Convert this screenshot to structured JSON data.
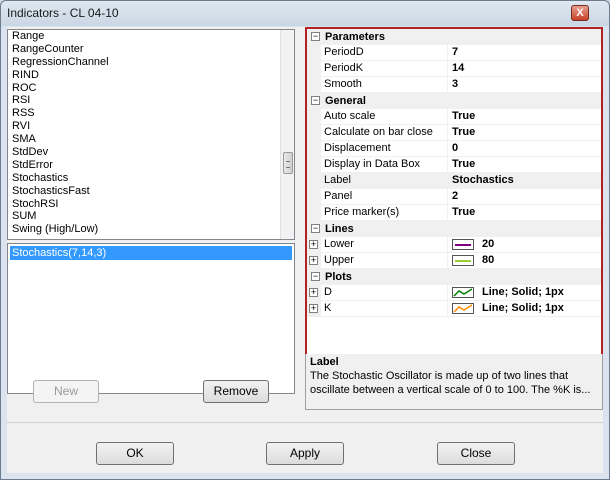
{
  "window": {
    "title": "Indicators - CL 04-10",
    "close_glyph": "X"
  },
  "indicator_list": {
    "items": [
      "Range",
      "RangeCounter",
      "RegressionChannel",
      "RIND",
      "ROC",
      "RSI",
      "RSS",
      "RVI",
      "SMA",
      "StdDev",
      "StdError",
      "Stochastics",
      "StochasticsFast",
      "StochRSI",
      "SUM",
      "Swing (High/Low)"
    ]
  },
  "applied_list": {
    "items": [
      "Stochastics(7,14,3)"
    ]
  },
  "buttons": {
    "new": "New",
    "remove": "Remove",
    "ok": "OK",
    "apply": "Apply",
    "close": "Close"
  },
  "properties": {
    "parameters": {
      "label": "Parameters",
      "rows": [
        {
          "name": "PeriodD",
          "value": "7"
        },
        {
          "name": "PeriodK",
          "value": "14"
        },
        {
          "name": "Smooth",
          "value": "3"
        }
      ]
    },
    "general": {
      "label": "General",
      "rows": [
        {
          "name": "Auto scale",
          "value": "True"
        },
        {
          "name": "Calculate on bar close",
          "value": "True"
        },
        {
          "name": "Displacement",
          "value": "0"
        },
        {
          "name": "Display in Data Box",
          "value": "True"
        },
        {
          "name": "Label",
          "value": "Stochastics"
        },
        {
          "name": "Panel",
          "value": "2"
        },
        {
          "name": "Price marker(s)",
          "value": "True"
        }
      ]
    },
    "lines": {
      "label": "Lines",
      "rows": [
        {
          "name": "Lower",
          "value": "20",
          "color": "#800080"
        },
        {
          "name": "Upper",
          "value": "80",
          "color": "#9acd32"
        }
      ]
    },
    "plots": {
      "label": "Plots",
      "rows": [
        {
          "name": "D",
          "value": "Line; Solid; 1px",
          "color": "#008000"
        },
        {
          "name": "K",
          "value": "Line; Solid; 1px",
          "color": "#ff8c00"
        }
      ]
    }
  },
  "description": {
    "title": "Label",
    "text": "The Stochastic Oscillator is made up of two lines that oscillate between a vertical scale of 0 to 100. The %K is..."
  },
  "icons": {
    "collapse": "−",
    "expand": "+"
  }
}
